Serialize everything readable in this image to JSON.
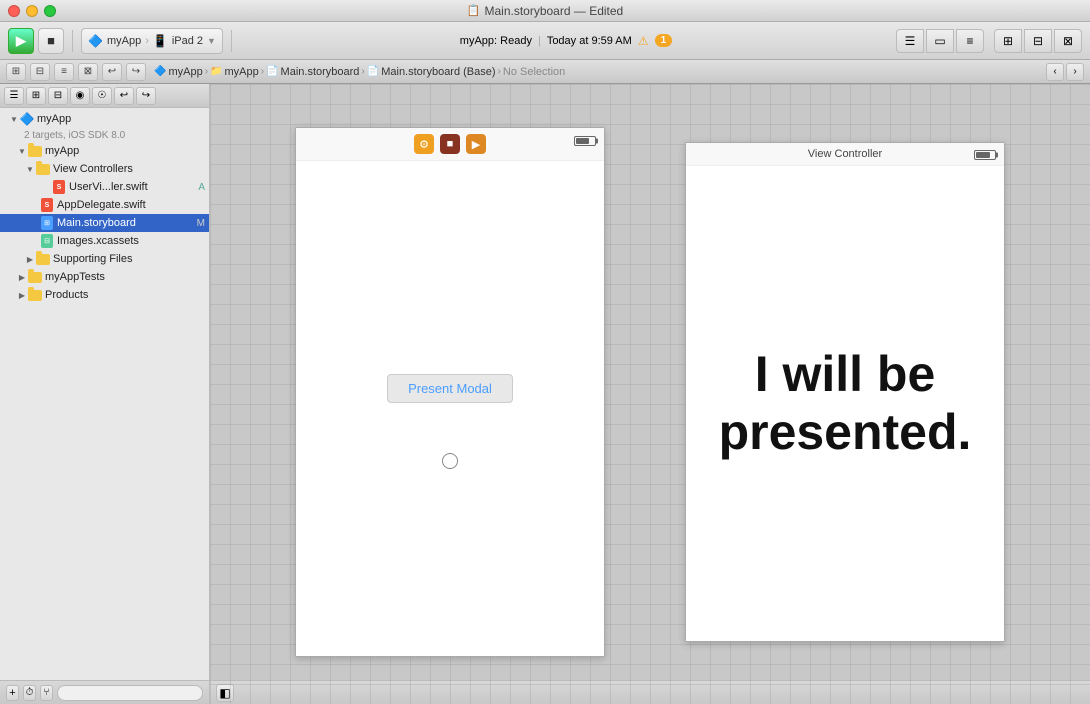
{
  "titlebar": {
    "title": "Main.storyboard — Edited",
    "icon": "📋"
  },
  "toolbar": {
    "run_label": "▶",
    "stop_label": "■",
    "scheme_app": "myApp",
    "scheme_device": "iPad 2",
    "status_text": "myApp: Ready",
    "status_time": "Today at 9:59 AM",
    "warning_count": "1"
  },
  "secondary_toolbar": {
    "breadcrumbs": [
      {
        "label": "myApp",
        "icon": "🔷"
      },
      {
        "label": "myApp",
        "icon": "📁"
      },
      {
        "label": "Main.storyboard",
        "icon": "📄"
      },
      {
        "label": "Main.storyboard (Base)",
        "icon": "📄"
      },
      {
        "label": "No Selection"
      }
    ]
  },
  "sidebar": {
    "project_name": "myApp",
    "project_subtitle": "2 targets, iOS SDK 8.0",
    "items": [
      {
        "label": "myApp",
        "type": "project",
        "depth": 0,
        "open": true,
        "badge": ""
      },
      {
        "label": "myApp",
        "type": "folder",
        "depth": 1,
        "open": true,
        "badge": ""
      },
      {
        "label": "View Controllers",
        "type": "folder",
        "depth": 2,
        "open": true,
        "badge": ""
      },
      {
        "label": "UserVi...ler.swift",
        "type": "swift",
        "depth": 3,
        "open": false,
        "badge": "A"
      },
      {
        "label": "AppDelegate.swift",
        "type": "swift",
        "depth": 2,
        "open": false,
        "badge": ""
      },
      {
        "label": "Main.storyboard",
        "type": "storyboard",
        "depth": 2,
        "open": false,
        "badge": "M",
        "selected": true
      },
      {
        "label": "Images.xcassets",
        "type": "xcassets",
        "depth": 2,
        "open": false,
        "badge": ""
      },
      {
        "label": "Supporting Files",
        "type": "folder",
        "depth": 2,
        "open": false,
        "badge": ""
      },
      {
        "label": "myAppTests",
        "type": "folder",
        "depth": 1,
        "open": false,
        "badge": ""
      },
      {
        "label": "Products",
        "type": "folder",
        "depth": 1,
        "open": false,
        "badge": ""
      }
    ]
  },
  "canvas": {
    "first_vc_title": "",
    "second_vc_title": "View Controller",
    "present_modal_btn": "Present Modal",
    "presented_text_line1": "I will be",
    "presented_text_line2": "presented.",
    "icons": [
      {
        "color": "orange",
        "symbol": "⚙"
      },
      {
        "color": "red",
        "symbol": "⬛"
      },
      {
        "color": "orange2",
        "symbol": "▶"
      }
    ]
  },
  "status_bar": {
    "add_btn": "+",
    "history_btn": "⏱",
    "branch_btn": "⑂",
    "filter_placeholder": ""
  }
}
